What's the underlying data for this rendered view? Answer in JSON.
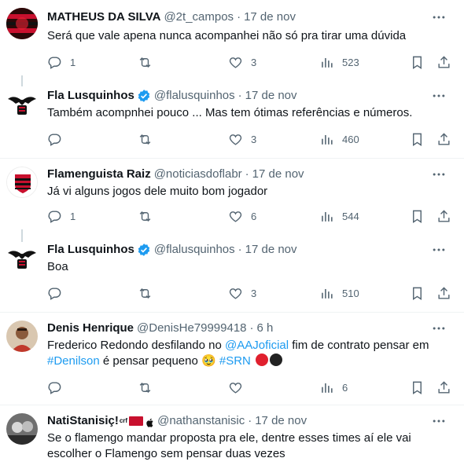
{
  "tweets": [
    {
      "name": "MATHEUS DA SILVA",
      "handle": "@2t_campos",
      "date": "17 de nov",
      "text": "Será que vale apena nunca acompanhei não só pra tirar uma dúvida",
      "replies": "1",
      "retweets": "",
      "likes": "3",
      "views": "523"
    },
    {
      "name": "Fla Lusquinhos",
      "handle": "@flalusquinhos",
      "date": "17 de nov",
      "text": "Também acompnhei pouco ... Mas tem ótimas referências e números.",
      "replies": "",
      "retweets": "",
      "likes": "3",
      "views": "460"
    },
    {
      "name": "Flamenguista Raiz",
      "handle": "@noticiasdoflabr",
      "date": "17 de nov",
      "text": "Já vi alguns jogos dele muito bom jogador",
      "replies": "1",
      "retweets": "",
      "likes": "6",
      "views": "544"
    },
    {
      "name": "Fla Lusquinhos",
      "handle": "@flalusquinhos",
      "date": "17 de nov",
      "text": "Boa",
      "replies": "",
      "retweets": "",
      "likes": "3",
      "views": "510"
    },
    {
      "name": "Denis Henrique",
      "handle": "@DenisHe79999418",
      "date": "6 h",
      "text_parts": {
        "p1": "Frederico Redondo desfilando no ",
        "mention": "@AAJoficial",
        "p2": " fim de contrato pensar em",
        "hashtag1": "#Denilson",
        "p3": " é pensar pequeno ",
        "emoji": "🥹",
        "hashtag2": "#SRN"
      },
      "replies": "",
      "retweets": "",
      "likes": "",
      "views": "6"
    },
    {
      "name": "NatiStanisiç!",
      "name_suffix": "crf",
      "handle": "@nathanstanisic",
      "date": "17 de nov",
      "text": "Se o flamengo mandar proposta pra ele, dentre esses times aí ele vai escolher o Flamengo sem pensar duas vezes"
    }
  ],
  "separator": "·",
  "logo_text": "Fla Lusquinhos",
  "colors": {
    "accent": "#1d9bf0",
    "muted": "#536471",
    "flamengo_red": "#c8102e",
    "verified": "#1d9bf0"
  }
}
